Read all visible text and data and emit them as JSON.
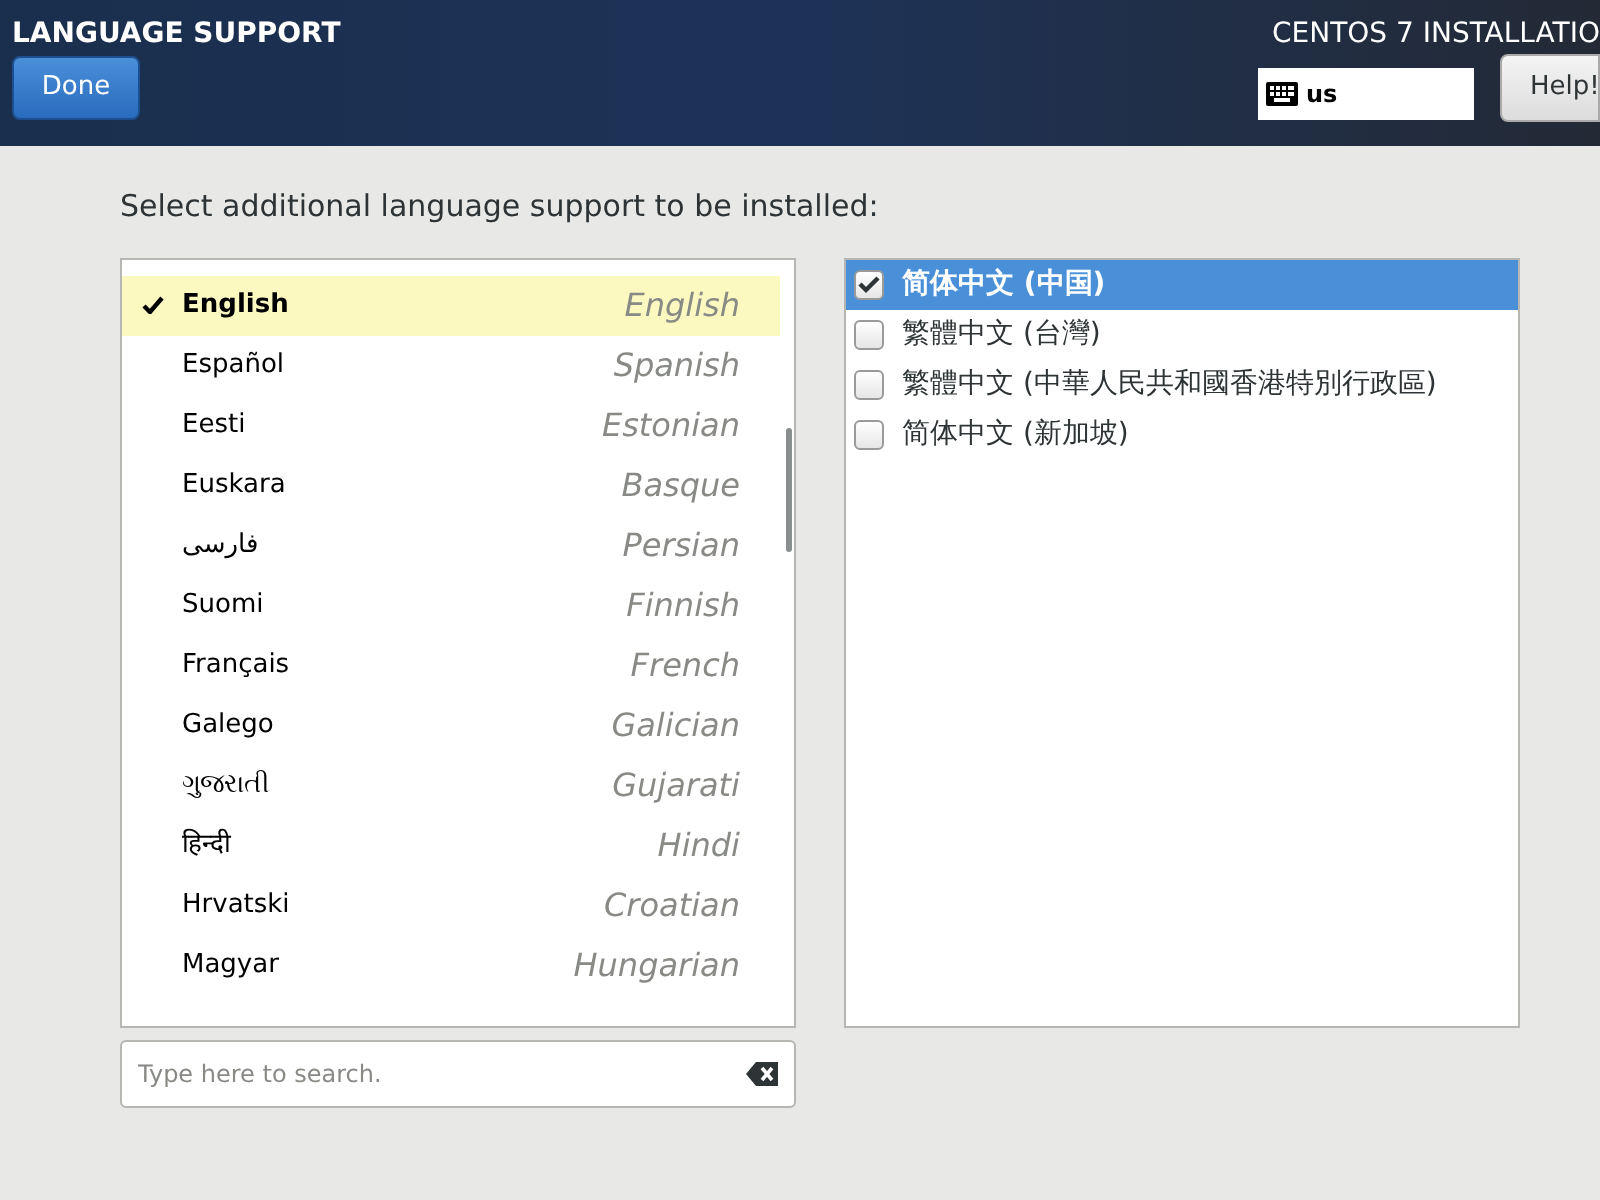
{
  "header": {
    "title": "LANGUAGE SUPPORT",
    "done_button": "Done",
    "product": "CENTOS 7 INSTALLATIO",
    "keyboard": "us",
    "help_button": "Help!"
  },
  "prompt": "Select additional language support to be installed:",
  "languages": [
    {
      "name": "English",
      "english": "English",
      "selected": true,
      "checked": true
    },
    {
      "name": "Español",
      "english": "Spanish",
      "selected": false,
      "checked": false
    },
    {
      "name": "Eesti",
      "english": "Estonian",
      "selected": false,
      "checked": false
    },
    {
      "name": "Euskara",
      "english": "Basque",
      "selected": false,
      "checked": false
    },
    {
      "name": "فارسی",
      "english": "Persian",
      "selected": false,
      "checked": false
    },
    {
      "name": "Suomi",
      "english": "Finnish",
      "selected": false,
      "checked": false
    },
    {
      "name": "Français",
      "english": "French",
      "selected": false,
      "checked": false
    },
    {
      "name": "Galego",
      "english": "Galician",
      "selected": false,
      "checked": false
    },
    {
      "name": "ગુજરાતી",
      "english": "Gujarati",
      "selected": false,
      "checked": false
    },
    {
      "name": "हिन्दी",
      "english": "Hindi",
      "selected": false,
      "checked": false
    },
    {
      "name": "Hrvatski",
      "english": "Croatian",
      "selected": false,
      "checked": false
    },
    {
      "name": "Magyar",
      "english": "Hungarian",
      "selected": false,
      "checked": false
    }
  ],
  "search": {
    "placeholder": "Type here to search."
  },
  "locales": [
    {
      "label": "简体中文 (中国)",
      "checked": true,
      "selected": true
    },
    {
      "label": "繁體中文 (台灣)",
      "checked": false,
      "selected": false
    },
    {
      "label": "繁體中文 (中華人民共和國香港特別行政區)",
      "checked": false,
      "selected": false
    },
    {
      "label": "简体中文 (新加坡)",
      "checked": false,
      "selected": false
    }
  ]
}
